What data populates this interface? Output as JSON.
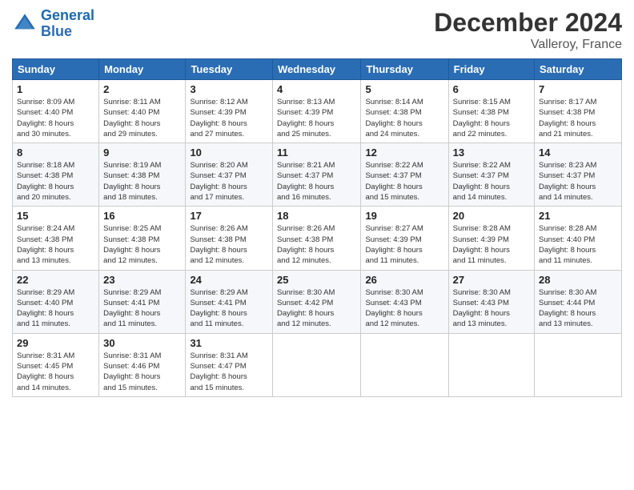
{
  "header": {
    "logo_line1": "General",
    "logo_line2": "Blue",
    "title": "December 2024",
    "subtitle": "Valleroy, France"
  },
  "days_of_week": [
    "Sunday",
    "Monday",
    "Tuesday",
    "Wednesday",
    "Thursday",
    "Friday",
    "Saturday"
  ],
  "weeks": [
    [
      {
        "day": "1",
        "info": "Sunrise: 8:09 AM\nSunset: 4:40 PM\nDaylight: 8 hours\nand 30 minutes."
      },
      {
        "day": "2",
        "info": "Sunrise: 8:11 AM\nSunset: 4:40 PM\nDaylight: 8 hours\nand 29 minutes."
      },
      {
        "day": "3",
        "info": "Sunrise: 8:12 AM\nSunset: 4:39 PM\nDaylight: 8 hours\nand 27 minutes."
      },
      {
        "day": "4",
        "info": "Sunrise: 8:13 AM\nSunset: 4:39 PM\nDaylight: 8 hours\nand 25 minutes."
      },
      {
        "day": "5",
        "info": "Sunrise: 8:14 AM\nSunset: 4:38 PM\nDaylight: 8 hours\nand 24 minutes."
      },
      {
        "day": "6",
        "info": "Sunrise: 8:15 AM\nSunset: 4:38 PM\nDaylight: 8 hours\nand 22 minutes."
      },
      {
        "day": "7",
        "info": "Sunrise: 8:17 AM\nSunset: 4:38 PM\nDaylight: 8 hours\nand 21 minutes."
      }
    ],
    [
      {
        "day": "8",
        "info": "Sunrise: 8:18 AM\nSunset: 4:38 PM\nDaylight: 8 hours\nand 20 minutes."
      },
      {
        "day": "9",
        "info": "Sunrise: 8:19 AM\nSunset: 4:38 PM\nDaylight: 8 hours\nand 18 minutes."
      },
      {
        "day": "10",
        "info": "Sunrise: 8:20 AM\nSunset: 4:37 PM\nDaylight: 8 hours\nand 17 minutes."
      },
      {
        "day": "11",
        "info": "Sunrise: 8:21 AM\nSunset: 4:37 PM\nDaylight: 8 hours\nand 16 minutes."
      },
      {
        "day": "12",
        "info": "Sunrise: 8:22 AM\nSunset: 4:37 PM\nDaylight: 8 hours\nand 15 minutes."
      },
      {
        "day": "13",
        "info": "Sunrise: 8:22 AM\nSunset: 4:37 PM\nDaylight: 8 hours\nand 14 minutes."
      },
      {
        "day": "14",
        "info": "Sunrise: 8:23 AM\nSunset: 4:37 PM\nDaylight: 8 hours\nand 14 minutes."
      }
    ],
    [
      {
        "day": "15",
        "info": "Sunrise: 8:24 AM\nSunset: 4:38 PM\nDaylight: 8 hours\nand 13 minutes."
      },
      {
        "day": "16",
        "info": "Sunrise: 8:25 AM\nSunset: 4:38 PM\nDaylight: 8 hours\nand 12 minutes."
      },
      {
        "day": "17",
        "info": "Sunrise: 8:26 AM\nSunset: 4:38 PM\nDaylight: 8 hours\nand 12 minutes."
      },
      {
        "day": "18",
        "info": "Sunrise: 8:26 AM\nSunset: 4:38 PM\nDaylight: 8 hours\nand 12 minutes."
      },
      {
        "day": "19",
        "info": "Sunrise: 8:27 AM\nSunset: 4:39 PM\nDaylight: 8 hours\nand 11 minutes."
      },
      {
        "day": "20",
        "info": "Sunrise: 8:28 AM\nSunset: 4:39 PM\nDaylight: 8 hours\nand 11 minutes."
      },
      {
        "day": "21",
        "info": "Sunrise: 8:28 AM\nSunset: 4:40 PM\nDaylight: 8 hours\nand 11 minutes."
      }
    ],
    [
      {
        "day": "22",
        "info": "Sunrise: 8:29 AM\nSunset: 4:40 PM\nDaylight: 8 hours\nand 11 minutes."
      },
      {
        "day": "23",
        "info": "Sunrise: 8:29 AM\nSunset: 4:41 PM\nDaylight: 8 hours\nand 11 minutes."
      },
      {
        "day": "24",
        "info": "Sunrise: 8:29 AM\nSunset: 4:41 PM\nDaylight: 8 hours\nand 11 minutes."
      },
      {
        "day": "25",
        "info": "Sunrise: 8:30 AM\nSunset: 4:42 PM\nDaylight: 8 hours\nand 12 minutes."
      },
      {
        "day": "26",
        "info": "Sunrise: 8:30 AM\nSunset: 4:43 PM\nDaylight: 8 hours\nand 12 minutes."
      },
      {
        "day": "27",
        "info": "Sunrise: 8:30 AM\nSunset: 4:43 PM\nDaylight: 8 hours\nand 13 minutes."
      },
      {
        "day": "28",
        "info": "Sunrise: 8:30 AM\nSunset: 4:44 PM\nDaylight: 8 hours\nand 13 minutes."
      }
    ],
    [
      {
        "day": "29",
        "info": "Sunrise: 8:31 AM\nSunset: 4:45 PM\nDaylight: 8 hours\nand 14 minutes."
      },
      {
        "day": "30",
        "info": "Sunrise: 8:31 AM\nSunset: 4:46 PM\nDaylight: 8 hours\nand 15 minutes."
      },
      {
        "day": "31",
        "info": "Sunrise: 8:31 AM\nSunset: 4:47 PM\nDaylight: 8 hours\nand 15 minutes."
      },
      null,
      null,
      null,
      null
    ]
  ]
}
